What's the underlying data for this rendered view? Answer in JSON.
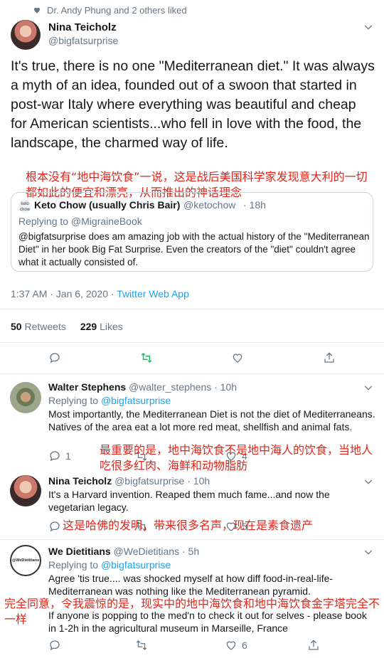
{
  "liked_by": "Dr. Andy Phung and 2 others liked",
  "main_tweet": {
    "author_name": "Nina Teicholz",
    "author_handle": "@bigfatsurprise",
    "text": "It's true, there is no one \"Mediterranean diet.\" It was always a myth of an idea, founded out of a swoon that started in post-war Italy where everything was beautiful and cheap for American scientists...who fell in love with the food, the landscape, the charmed way of life.",
    "annotation": "根本没有“地中海饮食”一说，这是战后美国科学家发现意大利的一切都如此的便宜和漂亮，从而推出的神话理念",
    "quoted": {
      "name": "Keto Chow (usually Chris Bair)",
      "handle": "@ketochow",
      "time": "· 18h",
      "avatar_text": "keto chow",
      "replying_to": "Replying to @MigraineBook",
      "text": "@bigfatsurprise does am amazing job with the actual history of the \"Mediterranean Diet\" in her book Big Fat Surprise. Even the creators of the \"diet\" couldn't agree what it actually consisted of."
    },
    "timestamp": "1:37 AM · Jan 6, 2020 ·",
    "source": "Twitter Web App",
    "retweets_count": "50",
    "retweets_label": "Retweets",
    "likes_count": "229",
    "likes_label": "Likes"
  },
  "replies": [
    {
      "name": "Walter Stephens",
      "handle": "@walter_stephens",
      "time": "· 10h",
      "replying_prefix": "Replying to",
      "replying_handle": "@bigfatsurprise",
      "text": "Most importantly, the Mediterranean Diet is not the diet of Mediterraneans. Natives of the area eat a lot more red meat, shellfish and animal fats.",
      "reply_count": "1",
      "retweet_count": "",
      "like_count": "4",
      "annotation": "最重要的是，地中海饮食不是地中海人的饮食，当地人吃很多红肉、海鲜和动物脂肪"
    },
    {
      "name": "Nina Teicholz",
      "handle": "@bigfatsurprise",
      "time": "· 10h",
      "text": "It's a Harvard invention. Reaped them much fame...and now the vegetarian legacy.",
      "like_count": "5",
      "annotation": "这是哈佛的发明，带来很多名声，现在是素食遗产"
    },
    {
      "name": "We Dietitians",
      "handle": "@WeDietitians",
      "time": "· 5h",
      "avatar_text": "@WeDietitians",
      "replying_prefix": "Replying to",
      "replying_handle": "@bigfatsurprise",
      "text_1": "Agree 'tis true.... was shocked myself at how diff food-in-real-life-Mediterranean was nothing like the Mediterranean pyramid.",
      "text_2": "If anyone is popping to the med'n to check it out for selves - please book in 1-2h in the agricultural museum in Marseille, France",
      "like_count": "6",
      "annotation": "完全同意，令我震惊的是，现实中的地中海饮食和地中海饮食金字塔完全不一样"
    }
  ],
  "colors": {
    "accent": "#1da1f2",
    "retweet_green": "#17bf63",
    "annotation_red": "#e0261b",
    "text": "#14171a",
    "muted": "#657786"
  }
}
